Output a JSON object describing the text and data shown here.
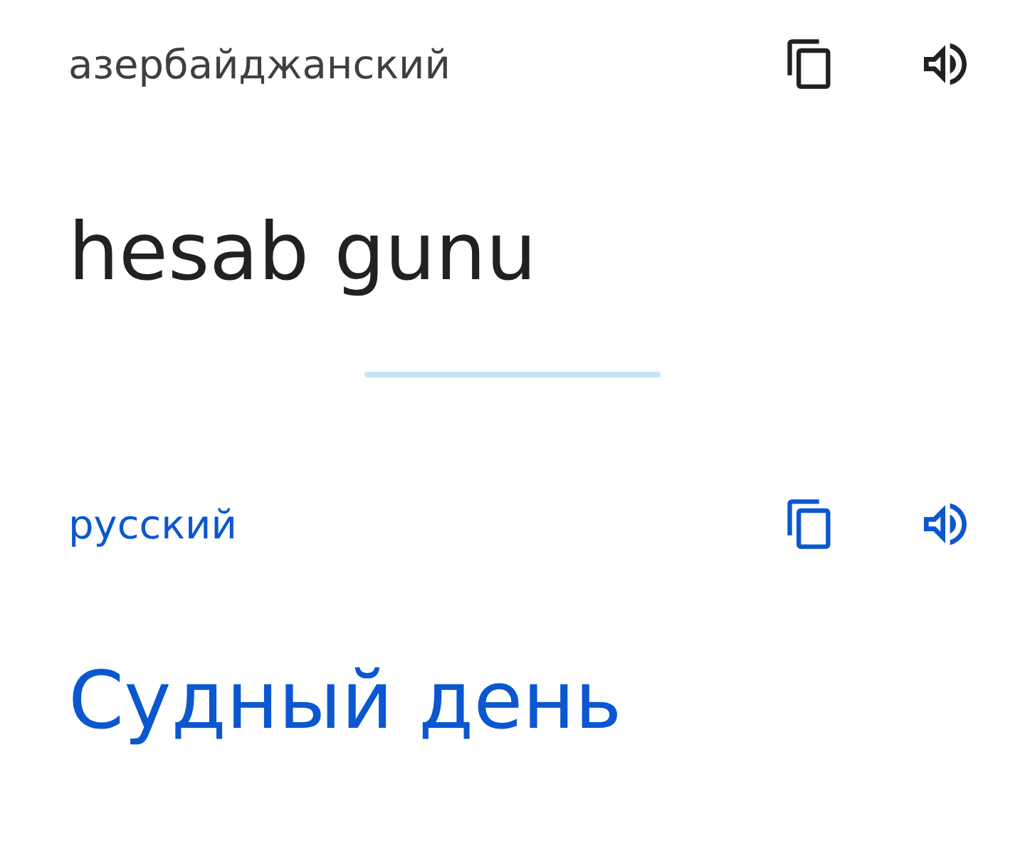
{
  "panels": [
    {
      "kind": "source",
      "language": "азербайджанский",
      "text": "hesab gunu"
    },
    {
      "kind": "target",
      "language": "русский",
      "text": "Судный день"
    }
  ]
}
